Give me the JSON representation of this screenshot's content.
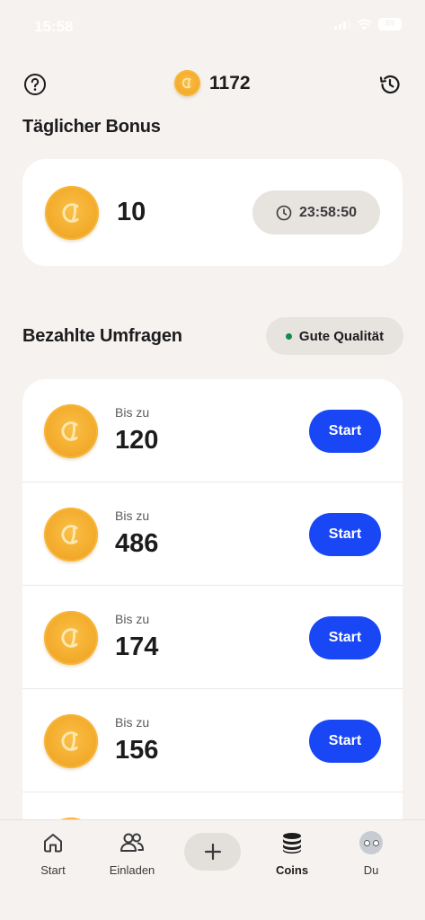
{
  "status_bar": {
    "time": "15:58",
    "battery": "89"
  },
  "header": {
    "balance": "1172",
    "help_icon": "help-circle-icon",
    "history_icon": "history-icon"
  },
  "daily_bonus": {
    "title": "Täglicher Bonus",
    "value": "10",
    "timer": "23:58:50"
  },
  "surveys": {
    "title": "Bezahlte Umfragen",
    "quality_label": "Gute Qualität",
    "quality_color": "#138a4b",
    "items": [
      {
        "prefix": "Bis zu",
        "value": "120",
        "button": "Start"
      },
      {
        "prefix": "Bis zu",
        "value": "486",
        "button": "Start"
      },
      {
        "prefix": "Bis zu",
        "value": "174",
        "button": "Start"
      },
      {
        "prefix": "Bis zu",
        "value": "156",
        "button": "Start"
      }
    ]
  },
  "tab_bar": {
    "start": "Start",
    "invite": "Einladen",
    "coins": "Coins",
    "you": "Du"
  },
  "colors": {
    "accent": "#1947f5",
    "background": "#f5f2ef",
    "coin": "#f4ad2e"
  }
}
